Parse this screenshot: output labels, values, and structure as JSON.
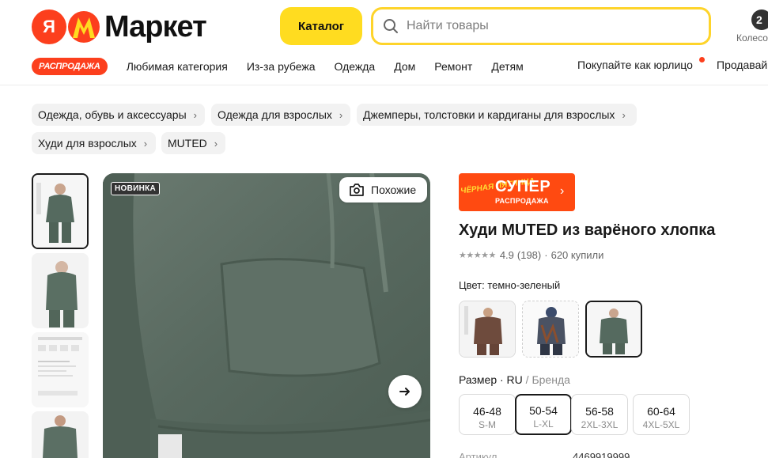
{
  "header": {
    "logo_letter": "Я",
    "logo_text": "Маркет",
    "catalog_label": "Каталог",
    "search_placeholder": "Найти товары",
    "cart_count": "2",
    "cart_label": "Колесо"
  },
  "nav": {
    "sale_label": "РАСПРОДАЖА",
    "items": [
      "Любимая категория",
      "Из-за рубежа",
      "Одежда",
      "Дом",
      "Ремонт",
      "Детям"
    ],
    "business_label": "Покупайте как юрлицо",
    "sell_label": "Продавай"
  },
  "breadcrumbs": [
    "Одежда, обувь и аксессуары",
    "Одежда для взрослых",
    "Джемперы, толстовки и кардиганы для взрослых",
    "Худи для взрослых",
    "MUTED"
  ],
  "gallery": {
    "badge": "НОВИНКА",
    "similar_label": "Похожие"
  },
  "promo": {
    "black_friday": "Чёрная пятница",
    "super": "СУПЕР",
    "sale": "РАСПРОДАЖА"
  },
  "product": {
    "title": "Худи MUTED из варёного хлопка",
    "stars": "★★★★★",
    "rating": "4.9",
    "reviews": "(198)",
    "separator": "·",
    "bought": "620 купили",
    "color_line": "Цвет: темно-зеленый",
    "size_label": "Размер · RU",
    "size_label_brand": " / Бренда",
    "sizes": [
      {
        "ru": "46-48",
        "brand": "S-M"
      },
      {
        "ru": "50-54",
        "brand": "L-XL"
      },
      {
        "ru": "56-58",
        "brand": "2XL-3XL"
      },
      {
        "ru": "60-64",
        "brand": "4XL-5XL"
      }
    ],
    "selected_size_index": 1,
    "article_label": "Артикул",
    "article_value": "4469919999"
  },
  "colors": {
    "accent_red": "#fc3f1d",
    "yellow": "#ffdc20",
    "hoodie_green": "#5d6d64"
  }
}
